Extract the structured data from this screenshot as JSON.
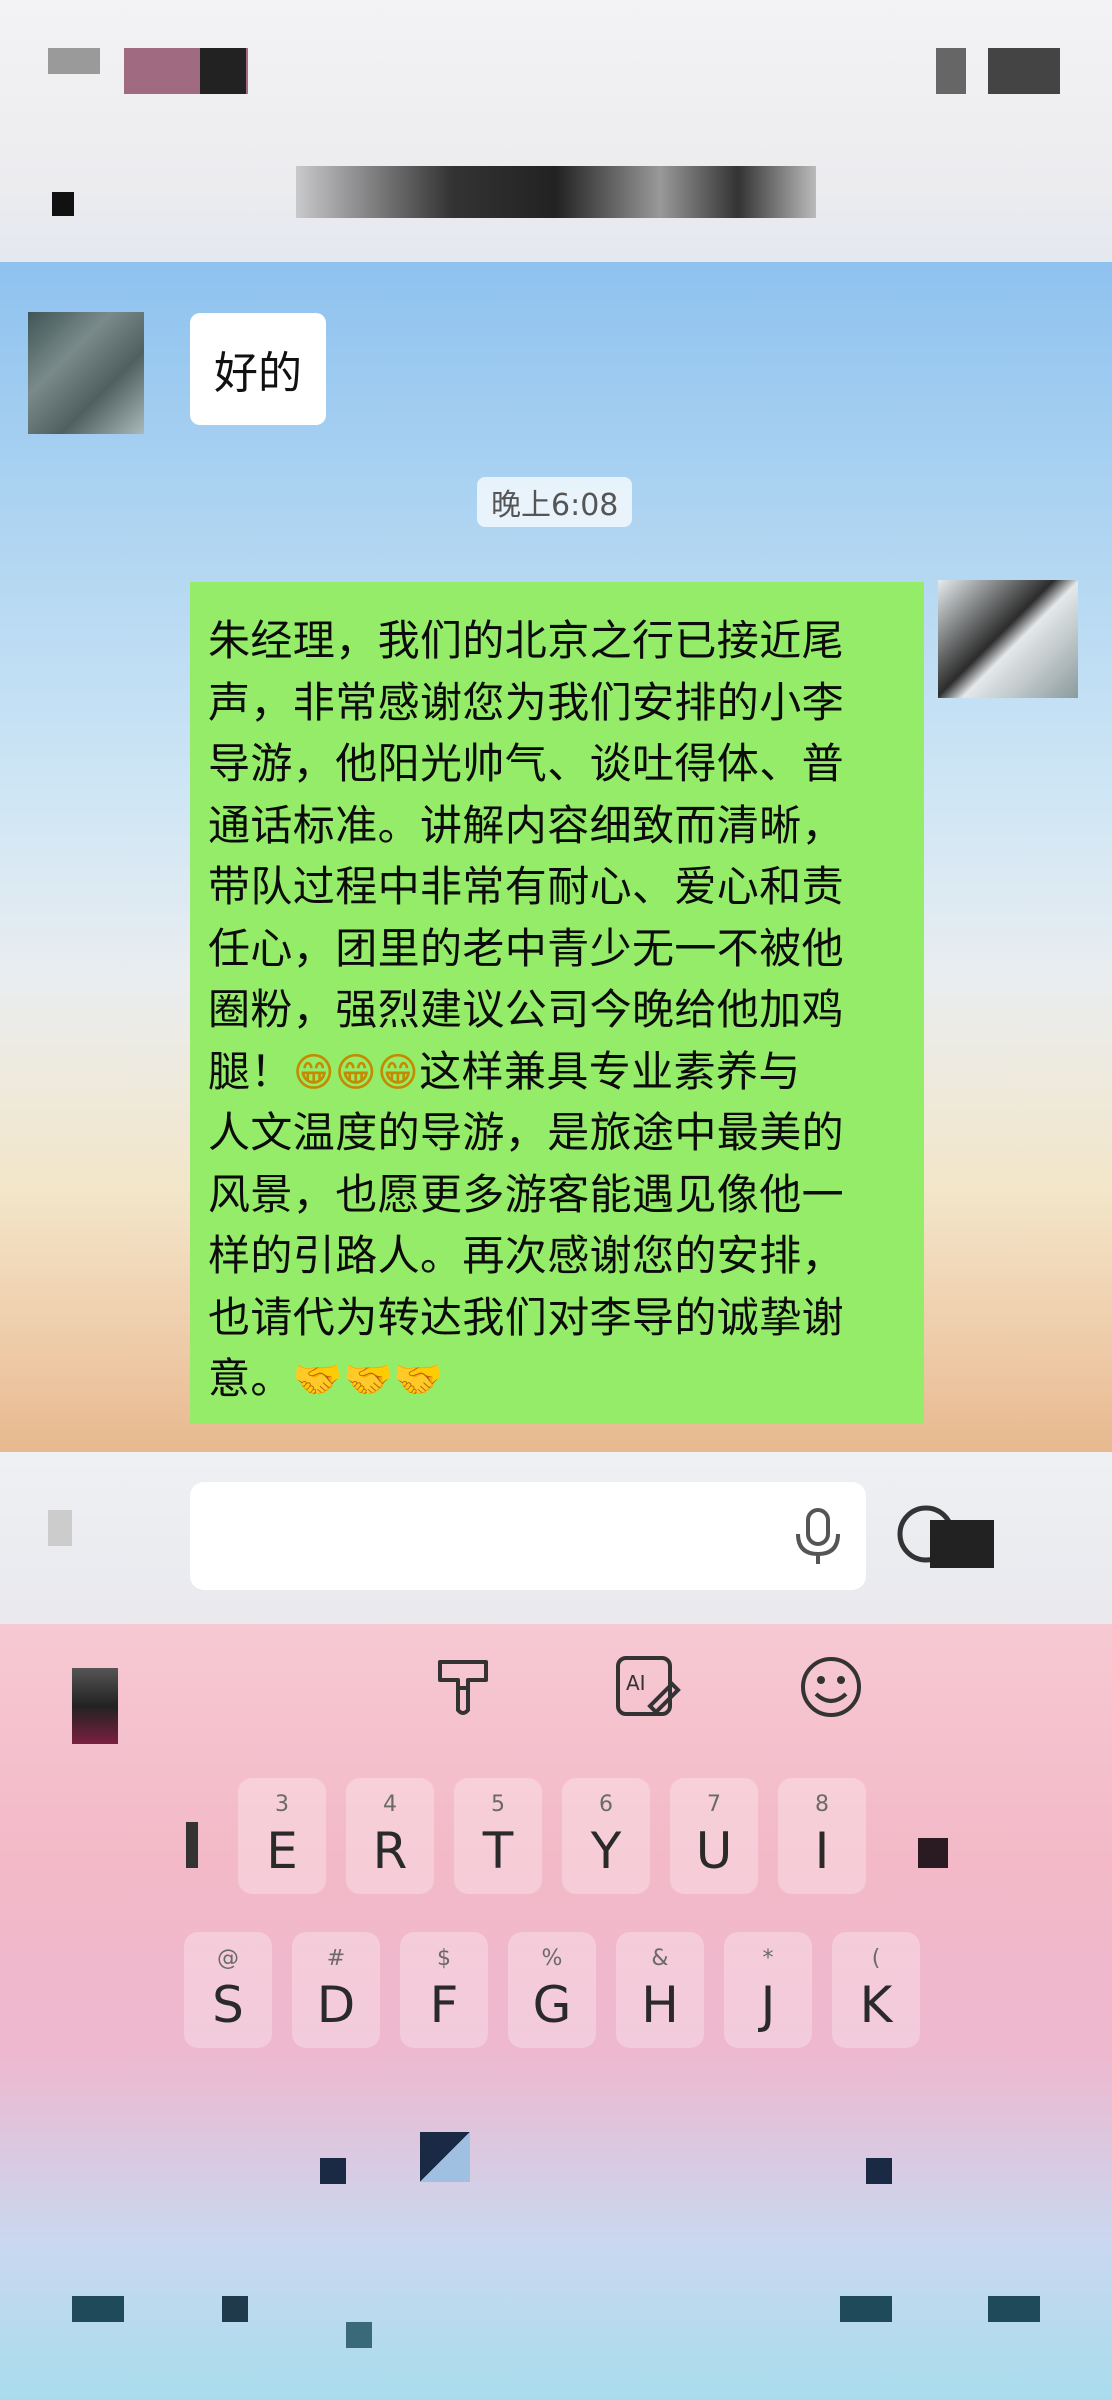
{
  "chat": {
    "messages": [
      {
        "side": "left",
        "text": "好的"
      },
      {
        "side": "right",
        "lines": [
          "朱经理，我们的北京之行已接近尾",
          "声，非常感谢您为我们安排的小李",
          "导游，他阳光帅气、谈吐得体、普",
          "通话标准。讲解内容细致而清晰，",
          "带队过程中非常有耐心、爱心和责",
          "任心，团里的老中青少无一不被他",
          "圈粉，强烈建议公司今晚给他加鸡",
          "腿！",
          "这样兼具专业素养与",
          "人文温度的导游，是旅途中最美的",
          "风景，也愿更多游客能遇见像他一",
          "样的引路人。再次感谢您的安排，",
          "也请代为转达我们对李导的诚挚谢",
          "意。"
        ]
      }
    ],
    "timestamp": "晚上6:08",
    "bubble_color": "#95ec69",
    "emoji": {
      "grin": "😁",
      "handshake": "🤝"
    }
  },
  "input": {
    "value": "",
    "icons": [
      "microphone-icon",
      "emoji-icon"
    ]
  },
  "keyboard": {
    "toolbar": [
      "brush-icon",
      "ai-write-icon",
      "smile-icon"
    ],
    "row1": [
      {
        "main": "E",
        "sub": "3"
      },
      {
        "main": "R",
        "sub": "4"
      },
      {
        "main": "T",
        "sub": "5"
      },
      {
        "main": "Y",
        "sub": "6"
      },
      {
        "main": "U",
        "sub": "7"
      },
      {
        "main": "I",
        "sub": "8"
      }
    ],
    "row2": [
      {
        "main": "S",
        "sub": "@"
      },
      {
        "main": "D",
        "sub": "#"
      },
      {
        "main": "F",
        "sub": "$"
      },
      {
        "main": "G",
        "sub": "%"
      },
      {
        "main": "H",
        "sub": "&"
      },
      {
        "main": "J",
        "sub": "*"
      },
      {
        "main": "K",
        "sub": "("
      }
    ]
  }
}
